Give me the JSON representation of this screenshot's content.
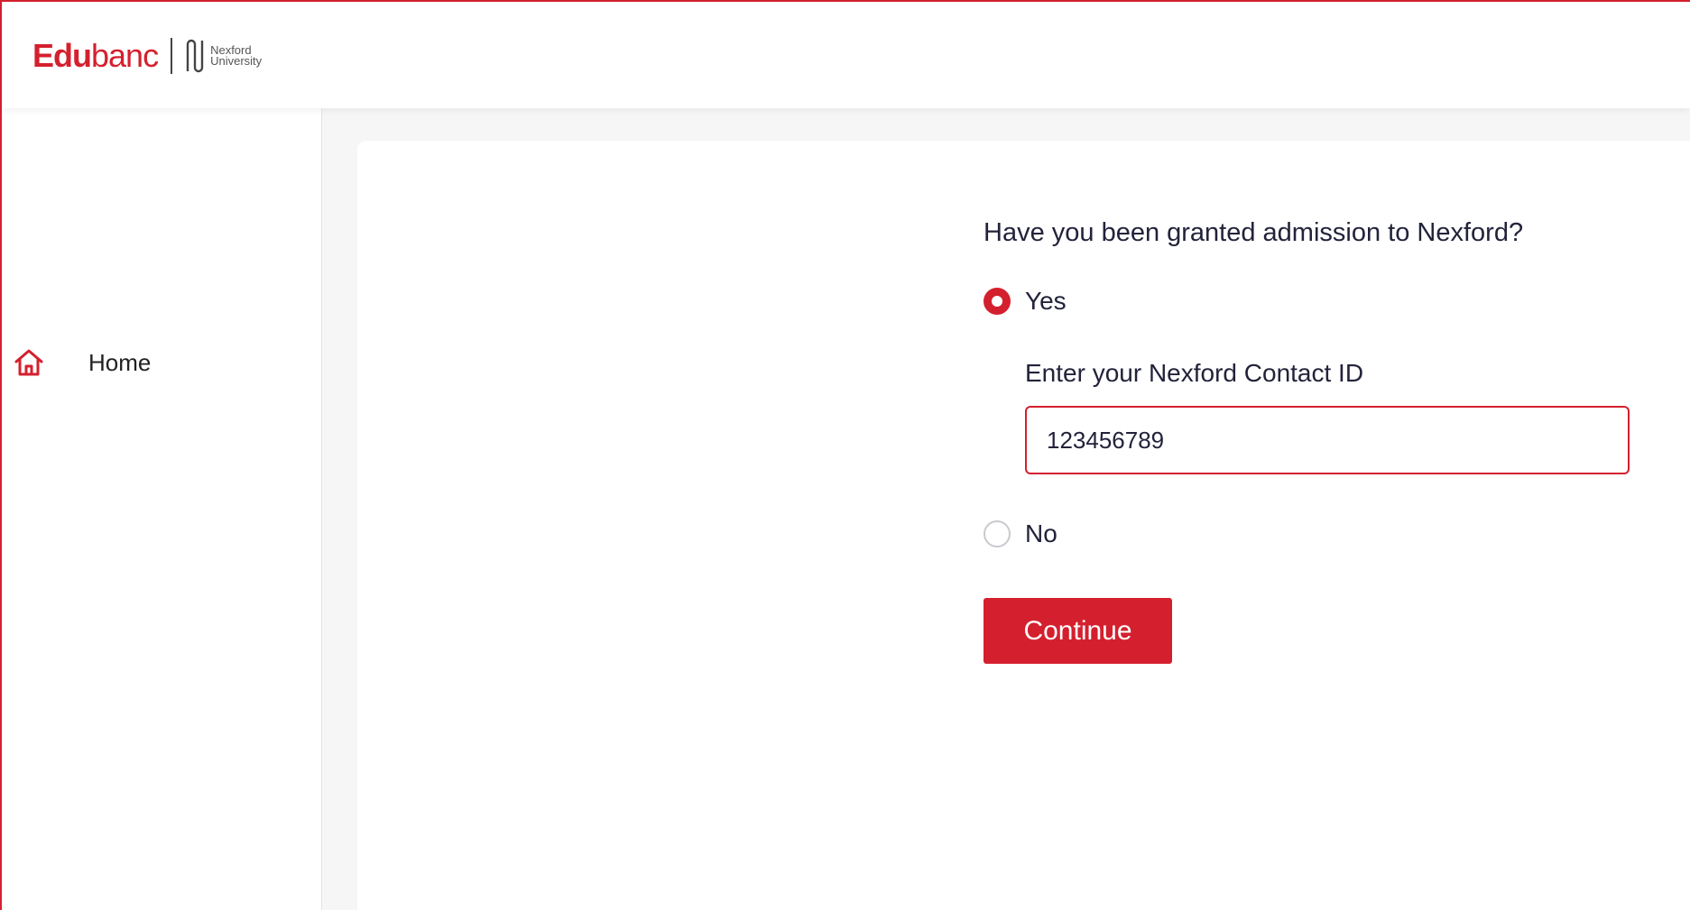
{
  "brand": {
    "name_bold": "Edu",
    "name_rest": "banc",
    "partner_line1": "Nexford",
    "partner_line2": "University",
    "accent_color": "#d4202e"
  },
  "sidebar": {
    "items": [
      {
        "label": "Home",
        "icon": "home-icon",
        "active": true
      }
    ]
  },
  "form": {
    "question": "Have you been granted admission to Nexford?",
    "options": [
      {
        "label": "Yes",
        "selected": true
      },
      {
        "label": "No",
        "selected": false
      }
    ],
    "contact_id_label": "Enter your Nexford Contact ID",
    "contact_id_value": "123456789",
    "submit_label": "Continue"
  }
}
